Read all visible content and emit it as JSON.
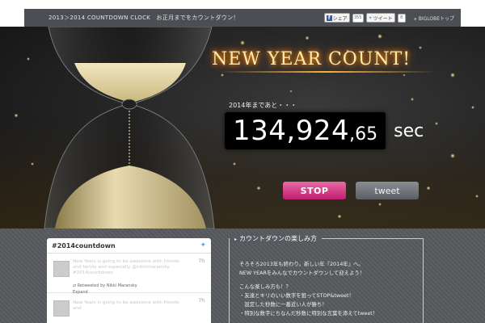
{
  "header": {
    "title": "2013＞2014 COUNTDOWN CLOCK　お正月までをカウントダウン！",
    "facebook_share": "シェア",
    "facebook_count": "355",
    "tweet_label": "ツイート",
    "tweet_count": "8",
    "biglobe_link": "BIGLOBEトップ"
  },
  "hero": {
    "banner": "NEW YEAR COUNT!",
    "until_label": "2014年まであと・・・",
    "counter_main": "134,924",
    "counter_comma": ",",
    "counter_fraction": "65",
    "counter_unit": "sec",
    "stop_button": "STOP",
    "tweet_button": "tweet"
  },
  "twitter_widget": {
    "hashtag": "#2014countdown",
    "tweets": [
      {
        "time": "7h",
        "text": "New Years is going to be awesome with friends and family and especially @niknimaransky #2014countdown",
        "retweeted_by": "Retweeted by Nikki Maransky",
        "expand": "Expand"
      },
      {
        "time": "7h",
        "text": "New Years is going to be awesome with friends and"
      }
    ]
  },
  "enjoy": {
    "title": "カウントダウンの楽しみ方",
    "lines": [
      "そろそろ2013年も終わり。新しい年『2014年』へ。",
      "NEW YEARをみんなでカウントダウンして迎えよう！",
      "こんな楽しみ方も！？",
      "・友達とキリのいい数字を狙ってSTOP&tweet！",
      "　設定した秒数に一番近い人が勝ち！",
      "・特別な数字にちなんだ秒数に特別な言葉を添えてtweet！"
    ]
  }
}
